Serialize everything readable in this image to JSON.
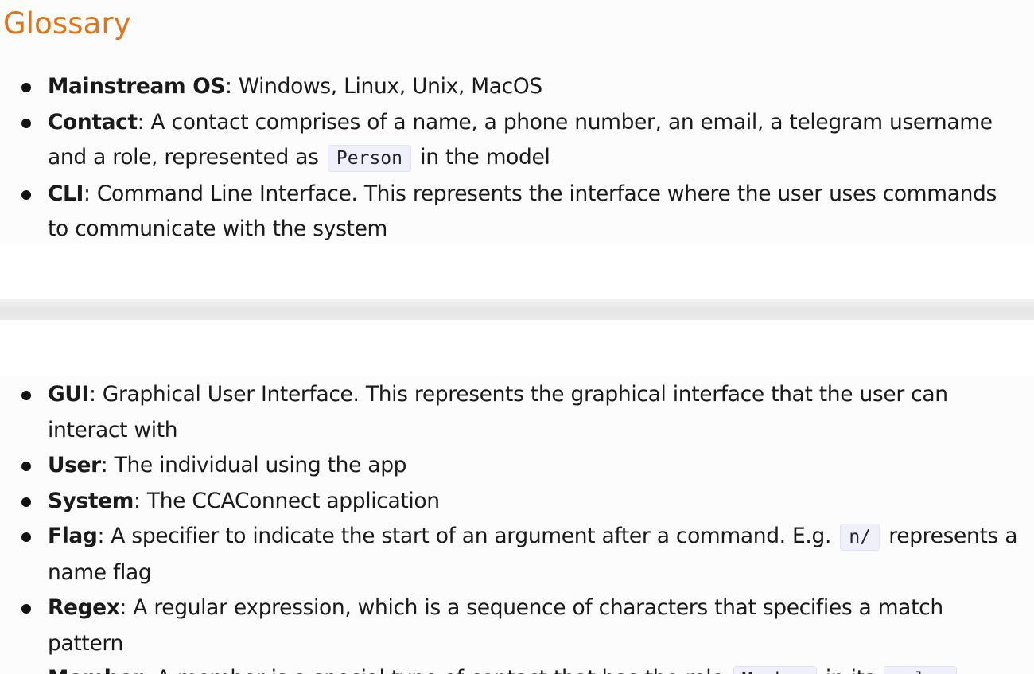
{
  "heading": "Glossary",
  "items": [
    {
      "term": "Mainstream OS",
      "sep": ":",
      "text": " Windows, Linux, Unix, MacOS"
    },
    {
      "term": "Contact",
      "sep": ":",
      "text_before": " A contact comprises of a name, a phone number, an email, a telegram username and a role, represented as ",
      "code": "Person",
      "text_after": " in the model"
    },
    {
      "term": "CLI",
      "sep": ":",
      "text": " Command Line Interface. This represents the interface where the user uses commands to communicate with the system"
    },
    {
      "term": "GUI",
      "sep": ":",
      "text": " Graphical User Interface. This represents the graphical interface that the user can interact with"
    },
    {
      "term": "User",
      "sep": ":",
      "text": " The individual using the app"
    },
    {
      "term": "System",
      "sep": ":",
      "text": " The CCAConnect application"
    },
    {
      "term": "Flag",
      "sep": ":",
      "text_before": " A specifier to indicate the start of an argument after a command. E.g. ",
      "code": "n/",
      "text_after": " represents a name flag"
    },
    {
      "term": "Regex",
      "sep": ":",
      "text": " A regular expression, which is a sequence of characters that specifies a match pattern"
    },
    {
      "term": "Member",
      "sep": ":",
      "text_before": " A member is a special type of contact that has the role ",
      "code": "Member",
      "text_middle": " in its ",
      "code2": "roles"
    }
  ]
}
